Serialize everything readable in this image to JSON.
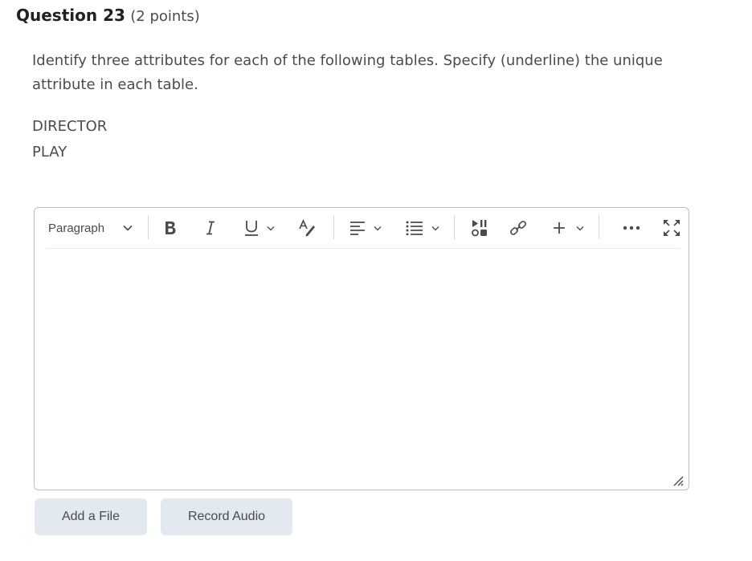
{
  "question": {
    "title": "Question 23",
    "points": "(2 points)",
    "text": "Identify three attributes for each of the following tables. Specify (underline) the unique attribute in each table.",
    "tables": [
      "DIRECTOR",
      "PLAY"
    ]
  },
  "toolbar": {
    "block_format": "Paragraph",
    "icons": [
      "chevron-down-icon",
      "bold-icon",
      "italic-icon",
      "underline-icon",
      "text-style-icon",
      "align-icon",
      "list-icon",
      "media-icon",
      "link-icon",
      "insert-plus-icon",
      "more-icon",
      "fullscreen-icon"
    ]
  },
  "buttons": {
    "add_file": "Add a File",
    "record_audio": "Record Audio"
  }
}
